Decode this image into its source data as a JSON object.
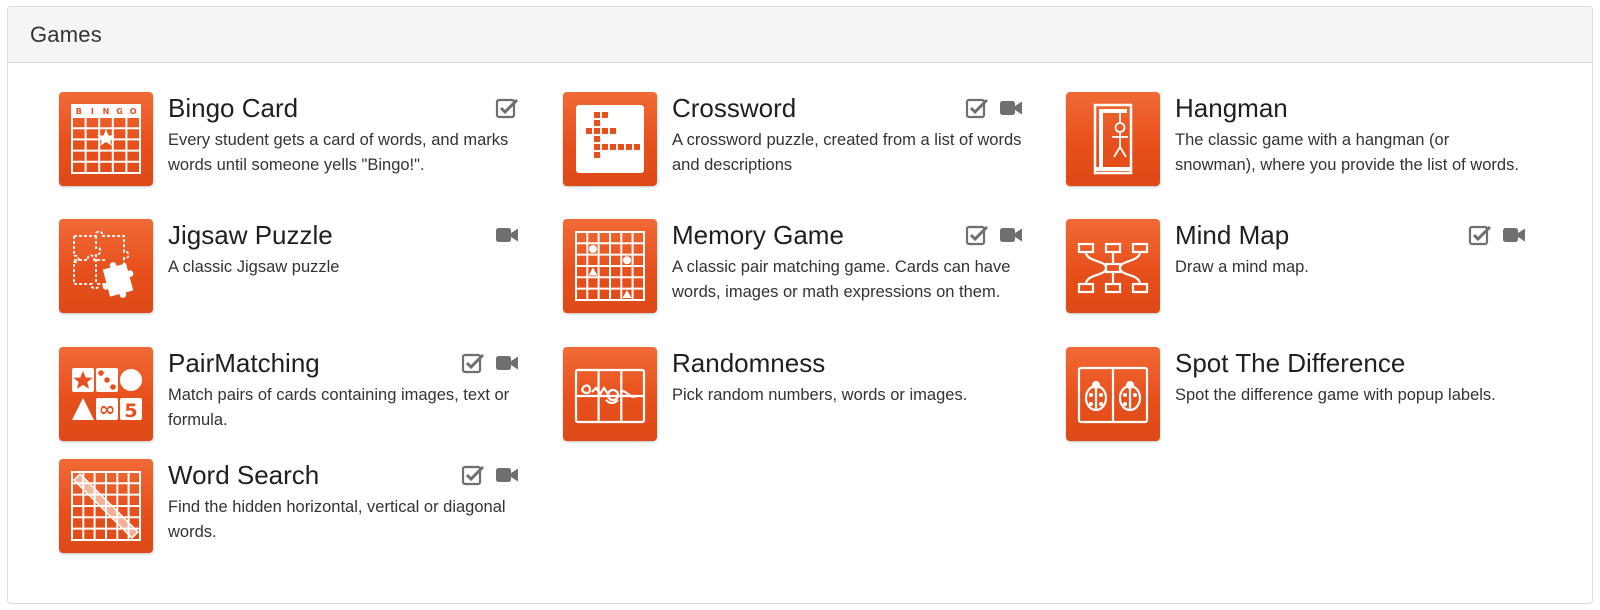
{
  "panel": {
    "title": "Games"
  },
  "games": [
    {
      "title": "Bingo Card",
      "desc": "Every student gets a card of words, and marks words until someone yells \"Bingo!\".",
      "icon": "bingo-icon",
      "check": true,
      "video": false,
      "bingo_letters": [
        "B",
        "I",
        "N",
        "G",
        "O"
      ]
    },
    {
      "title": "Crossword",
      "desc": "A crossword puzzle, created from a list of words and descriptions",
      "icon": "crossword-icon",
      "check": true,
      "video": true
    },
    {
      "title": "Hangman",
      "desc": "The classic game with a hangman (or snowman), where you provide the list of words.",
      "icon": "hangman-icon",
      "check": false,
      "video": false
    },
    {
      "title": "Jigsaw Puzzle",
      "desc": "A classic Jigsaw puzzle",
      "icon": "jigsaw-icon",
      "check": false,
      "video": true
    },
    {
      "title": "Memory Game",
      "desc": "A classic pair matching game. Cards can have words, images or math expressions on them.",
      "icon": "memory-icon",
      "check": true,
      "video": true
    },
    {
      "title": "Mind Map",
      "desc": "Draw a mind map.",
      "icon": "mindmap-icon",
      "check": true,
      "video": true
    },
    {
      "title": "PairMatching",
      "desc": "Match pairs of cards containing images, text or formula.",
      "icon": "pairmatching-icon",
      "check": true,
      "video": true,
      "tile_symbols": [
        "∞",
        "5"
      ]
    },
    {
      "title": "Randomness",
      "desc": "Pick random numbers, words or images.",
      "icon": "randomness-icon",
      "check": false,
      "video": false
    },
    {
      "title": "Spot The Difference",
      "desc": "Spot the difference game with popup labels.",
      "icon": "spot-difference-icon",
      "check": false,
      "video": false
    },
    {
      "title": "Word Search",
      "desc": "Find the hidden horizontal, vertical or diagonal words.",
      "icon": "wordsearch-icon",
      "check": true,
      "video": true
    }
  ],
  "colors": {
    "accent": "#e7501d",
    "icon_gray": "#6f6f6f"
  }
}
